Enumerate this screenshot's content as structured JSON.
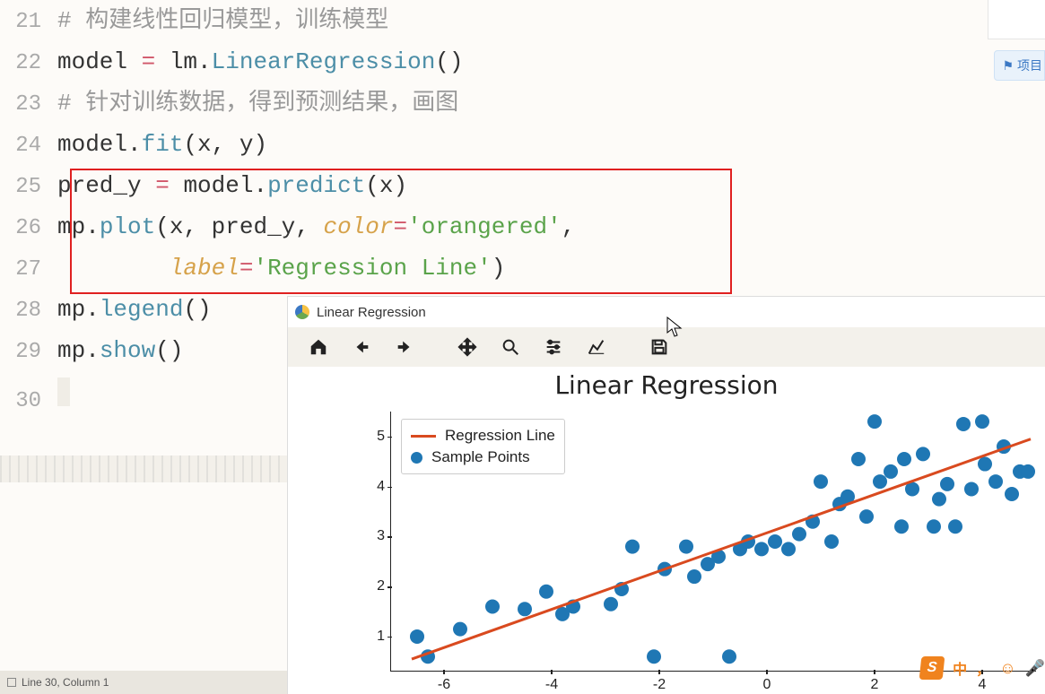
{
  "gutter": {
    "l21": "21",
    "l22": "22",
    "l23": "23",
    "l24": "24",
    "l25": "25",
    "l26": "26",
    "l27": "27",
    "l28": "28",
    "l29": "29",
    "l30": "30"
  },
  "code": {
    "l21_comment": "# 构建线性回归模型，训练模型",
    "l22_model": "model",
    "l22_eq": " = ",
    "l22_lm": "lm",
    "l22_dot": ".",
    "l22_LR": "LinearRegression",
    "l22_par": "()",
    "l23_comment": "# 针对训练数据，得到预测结果，画图",
    "l24_model": "model",
    "l24_dot": ".",
    "l24_fit": "fit",
    "l24_args": "(x, y)",
    "l25_predy": "pred_y",
    "l25_eq": " = ",
    "l25_model": "model",
    "l25_dot": ".",
    "l25_predict": "predict",
    "l25_args": "(x)",
    "l26_mp": "mp",
    "l26_dot": ".",
    "l26_plot": "plot",
    "l26_open": "(x, pred_y, ",
    "l26_ckey": "color",
    "l26_ceq": "=",
    "l26_q1": "'",
    "l26_cval": "orangered",
    "l26_q2": "'",
    "l26_comma": ",",
    "l27_indent": "        ",
    "l27_lkey": "label",
    "l27_leq": "=",
    "l27_q1": "'",
    "l27_lval": "Regression Line",
    "l27_q2": "'",
    "l27_close": ")",
    "l28_mp": "mp",
    "l28_dot": ".",
    "l28_legend": "legend",
    "l28_par": "()",
    "l29_mp": "mp",
    "l29_dot": ".",
    "l29_show": "show",
    "l29_par": "()"
  },
  "statusbar": {
    "text": "Line 30, Column 1"
  },
  "mpl": {
    "window_title": "Linear Regression",
    "toolbar": {
      "home": "home",
      "back": "back",
      "forward": "forward",
      "pan": "pan",
      "zoom": "zoom",
      "configure": "configure",
      "axes": "axes",
      "save": "save"
    }
  },
  "chart_data": {
    "type": "scatter+line",
    "title": "Linear Regression",
    "xlabel": "",
    "ylabel": "",
    "xlim": [
      -7,
      5
    ],
    "ylim": [
      0.3,
      5.5
    ],
    "xticks": [
      -6,
      -4,
      -2,
      0,
      2,
      4
    ],
    "yticks": [
      1,
      2,
      3,
      4,
      5
    ],
    "series": [
      {
        "name": "Regression Line",
        "type": "line",
        "color": "#d94a1f",
        "points": [
          [
            -6.6,
            0.55
          ],
          [
            4.9,
            4.95
          ]
        ]
      },
      {
        "name": "Sample Points",
        "type": "scatter",
        "color": "#1f77b4",
        "points": [
          [
            -6.5,
            1.0
          ],
          [
            -6.3,
            0.6
          ],
          [
            -5.7,
            1.15
          ],
          [
            -5.1,
            1.6
          ],
          [
            -4.5,
            1.55
          ],
          [
            -4.1,
            1.9
          ],
          [
            -3.8,
            1.45
          ],
          [
            -3.6,
            1.6
          ],
          [
            -2.9,
            1.65
          ],
          [
            -2.7,
            1.95
          ],
          [
            -2.5,
            2.8
          ],
          [
            -2.1,
            0.6
          ],
          [
            -1.9,
            2.35
          ],
          [
            -1.5,
            2.8
          ],
          [
            -1.35,
            2.2
          ],
          [
            -1.1,
            2.45
          ],
          [
            -0.9,
            2.6
          ],
          [
            -0.7,
            0.6
          ],
          [
            -0.5,
            2.75
          ],
          [
            -0.35,
            2.9
          ],
          [
            -0.1,
            2.75
          ],
          [
            0.15,
            2.9
          ],
          [
            0.4,
            2.75
          ],
          [
            0.6,
            3.05
          ],
          [
            0.85,
            3.3
          ],
          [
            1.0,
            4.1
          ],
          [
            1.2,
            2.9
          ],
          [
            1.35,
            3.65
          ],
          [
            1.5,
            3.8
          ],
          [
            1.7,
            4.55
          ],
          [
            1.85,
            3.4
          ],
          [
            2.0,
            5.3
          ],
          [
            2.1,
            4.1
          ],
          [
            2.3,
            4.3
          ],
          [
            2.5,
            3.2
          ],
          [
            2.55,
            4.55
          ],
          [
            2.7,
            3.95
          ],
          [
            2.9,
            4.65
          ],
          [
            3.1,
            3.2
          ],
          [
            3.2,
            3.75
          ],
          [
            3.35,
            4.05
          ],
          [
            3.5,
            3.2
          ],
          [
            3.65,
            5.25
          ],
          [
            3.8,
            3.95
          ],
          [
            4.0,
            5.3
          ],
          [
            4.05,
            4.45
          ],
          [
            4.25,
            4.1
          ],
          [
            4.4,
            4.8
          ],
          [
            4.55,
            3.85
          ],
          [
            4.7,
            4.3
          ],
          [
            4.85,
            4.3
          ]
        ]
      }
    ],
    "legend": {
      "position": "upper left",
      "entries": [
        "Regression Line",
        "Sample Points"
      ]
    }
  },
  "side": {
    "flag_label": "项目",
    "ime_lang": "中",
    "ime_punct": "，"
  },
  "colors": {
    "highlight": "#e02020",
    "regline": "#d94a1f",
    "points": "#1f77b4",
    "accent": "#f0831e"
  }
}
